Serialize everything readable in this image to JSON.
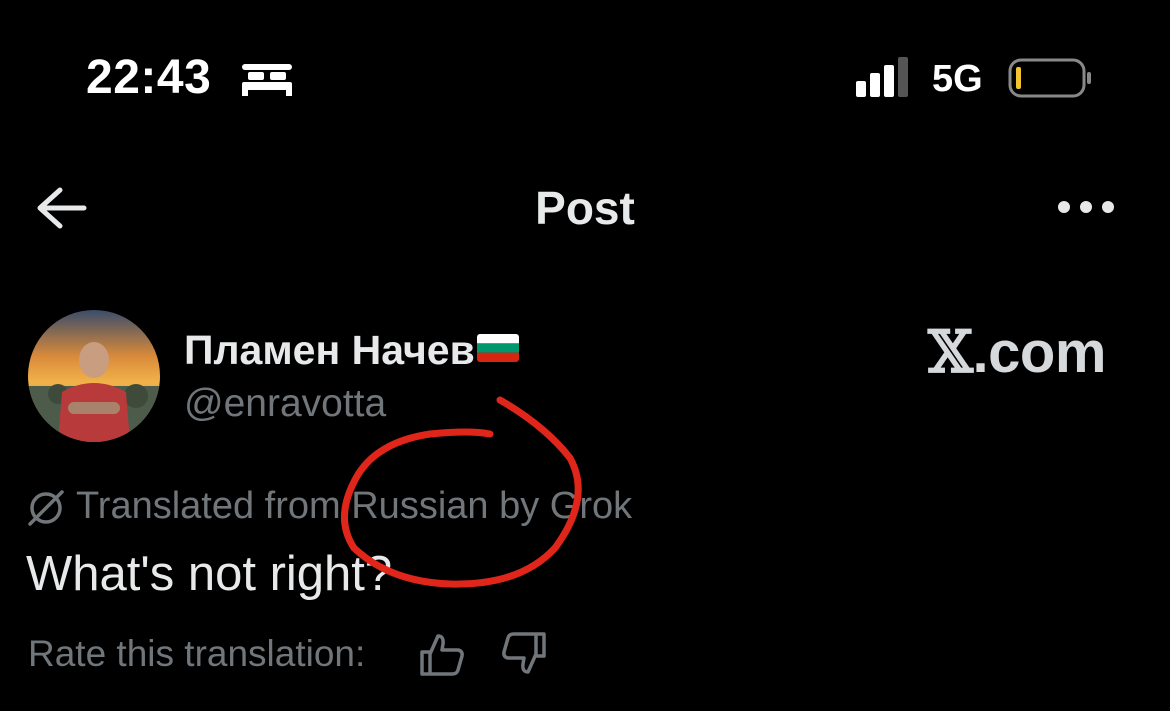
{
  "status_bar": {
    "time": "22:43",
    "network": "5G",
    "icons": [
      "bed-icon",
      "signal-icon",
      "battery-icon"
    ]
  },
  "nav": {
    "title": "Post",
    "icons": [
      "back-arrow-icon",
      "more-dots-icon"
    ]
  },
  "post": {
    "author_name": "Пламен Начев",
    "author_handle": "@enravotta",
    "flag": "bulgarian-flag",
    "translation_label": "Translated from Russian by Grok",
    "text": "What's not right?",
    "rate_label": "Rate this translation:",
    "icons": [
      "grok-icon",
      "thumbs-up-icon",
      "thumbs-down-icon"
    ]
  },
  "watermark": {
    "x": "𝕏",
    "domain": ".com"
  },
  "colors": {
    "background": "#000000",
    "primary_text": "#e7e9ea",
    "secondary_text": "#71767b",
    "annotation": "#e0261b"
  }
}
